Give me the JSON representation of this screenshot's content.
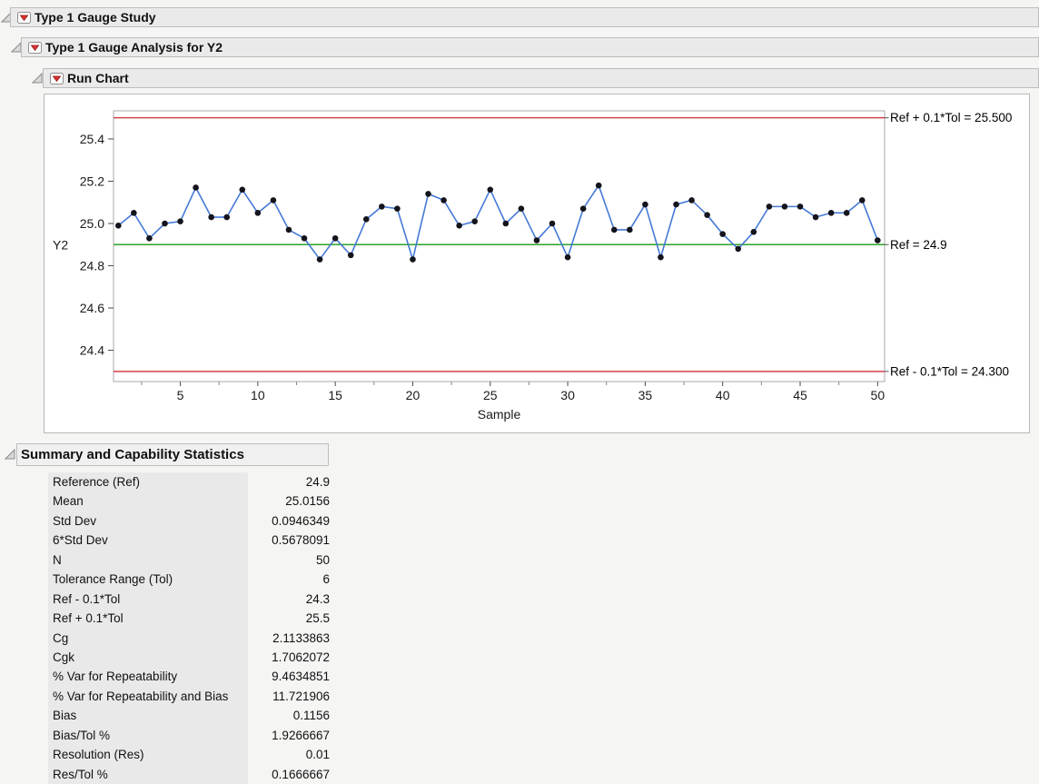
{
  "outline": [
    {
      "title": "Type 1 Gauge Study"
    },
    {
      "title": "Type 1 Gauge Analysis for Y2"
    },
    {
      "title": "Run Chart"
    }
  ],
  "summary": {
    "title": "Summary and Capability Statistics",
    "rows": [
      {
        "label": "Reference (Ref)",
        "value": "24.9"
      },
      {
        "label": "Mean",
        "value": "25.0156"
      },
      {
        "label": "Std Dev",
        "value": "0.0946349"
      },
      {
        "label": "6*Std Dev",
        "value": "0.5678091"
      },
      {
        "label": "N",
        "value": "50"
      },
      {
        "label": "Tolerance Range (Tol)",
        "value": "6"
      },
      {
        "label": "Ref - 0.1*Tol",
        "value": "24.3"
      },
      {
        "label": "Ref + 0.1*Tol",
        "value": "25.5"
      },
      {
        "label": "Cg",
        "value": "2.1133863"
      },
      {
        "label": "Cgk",
        "value": "1.7062072"
      },
      {
        "label": "% Var for Repeatability",
        "value": "9.4634851"
      },
      {
        "label": "% Var for Repeatability and Bias",
        "value": "11.721906"
      },
      {
        "label": "Bias",
        "value": "0.1156"
      },
      {
        "label": "Bias/Tol %",
        "value": "1.9266667"
      },
      {
        "label": "Resolution (Res)",
        "value": "0.01"
      },
      {
        "label": "Res/Tol %",
        "value": "0.1666667"
      }
    ]
  },
  "icons": {
    "disclosure": "disclosure-triangle-open",
    "menu": "red-triangle-menu"
  },
  "chart_data": {
    "type": "line",
    "title": "Run Chart",
    "xlabel": "Sample",
    "ylabel": "Y2",
    "x": [
      1,
      2,
      3,
      4,
      5,
      6,
      7,
      8,
      9,
      10,
      11,
      12,
      13,
      14,
      15,
      16,
      17,
      18,
      19,
      20,
      21,
      22,
      23,
      24,
      25,
      26,
      27,
      28,
      29,
      30,
      31,
      32,
      33,
      34,
      35,
      36,
      37,
      38,
      39,
      40,
      41,
      42,
      43,
      44,
      45,
      46,
      47,
      48,
      49,
      50
    ],
    "y": [
      24.99,
      25.05,
      24.93,
      25.0,
      25.01,
      25.17,
      25.03,
      25.03,
      25.16,
      25.05,
      25.11,
      24.97,
      24.93,
      24.83,
      24.93,
      24.85,
      25.02,
      25.08,
      25.07,
      24.83,
      25.14,
      25.11,
      24.99,
      25.01,
      25.16,
      25.0,
      25.07,
      24.92,
      25.0,
      24.84,
      25.07,
      25.18,
      24.97,
      24.97,
      25.09,
      24.84,
      25.09,
      25.11,
      25.04,
      24.95,
      24.88,
      24.96,
      25.08,
      25.08,
      25.08,
      25.03,
      25.05,
      25.05,
      25.11,
      24.92
    ],
    "xlim": [
      0.69,
      50.45
    ],
    "ylim": [
      24.252,
      25.533
    ],
    "y_tick_values": [
      25.4,
      25.2,
      25.0,
      24.8,
      24.6,
      24.4
    ],
    "y_tick_labels": [
      "25.4",
      "25.2",
      "25.0",
      "24.8",
      "24.6",
      "24.4"
    ],
    "x_major_ticks": [
      5,
      10,
      15,
      20,
      25,
      30,
      35,
      40,
      45,
      50
    ],
    "x_minor_ticks": [
      2.5,
      7.5,
      12.5,
      17.5,
      22.5,
      27.5,
      32.5,
      37.5,
      42.5,
      47.5
    ],
    "ref_lines": [
      {
        "value": 25.5,
        "label": "Ref + 0.1*Tol = 25.500",
        "color": "#d5404a"
      },
      {
        "value": 24.9,
        "label": "Ref = 24.9",
        "color": "#2aa22a"
      },
      {
        "value": 24.3,
        "label": "Ref - 0.1*Tol = 24.300",
        "color": "#d5404a"
      }
    ],
    "line_color": "#4579d6",
    "marker_color": "#14141c",
    "grid": false,
    "legend": "none"
  }
}
